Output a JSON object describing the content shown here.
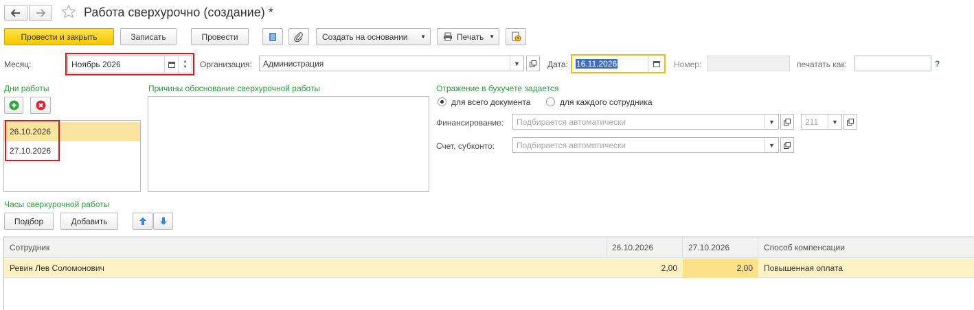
{
  "window": {
    "title": "Работа сверхурочно (создание) *"
  },
  "toolbar": {
    "post_close_label": "Провести и закрыть",
    "save_label": "Записать",
    "post_label": "Провести",
    "create_based_label": "Создать на основании",
    "print_label": "Печать"
  },
  "header": {
    "month_label": "Месяц:",
    "month_value": "Ноябрь 2026",
    "org_label": "Организация:",
    "org_value": "Администрация",
    "date_label": "Дата:",
    "date_value": "16.11.2026",
    "number_label": "Номер:",
    "number_value": "",
    "print_as_label": "печатать как:",
    "print_as_value": "",
    "help_label": "?"
  },
  "work_days": {
    "title": "Дни работы",
    "items": [
      "26.10.2026",
      "27.10.2026"
    ],
    "selected_index": 0
  },
  "reasons": {
    "title": "Причины обоснование сверхурочной работы",
    "value": ""
  },
  "accounting": {
    "title": "Отражение в бухучете задается",
    "radio_whole_doc": "для всего документа",
    "radio_each_employee": "для каждого сотрудника",
    "selected": "для всего документа",
    "financing_label": "Финансирование:",
    "financing_placeholder": "Подбирается автоматически",
    "financing_code_placeholder": "211",
    "account_label": "Счет, субконто:",
    "account_placeholder": "Подбирается автоматически"
  },
  "overtime": {
    "title": "Часы сверхурочной работы",
    "pick_label": "Подбор",
    "add_label": "Добавить",
    "columns": [
      "Сотрудник",
      "26.10.2026",
      "27.10.2026",
      "Способ компенсации"
    ],
    "rows": [
      {
        "employee": "Ревин Лев Соломонович",
        "d1": "2,00",
        "d2": "2,00",
        "compensation": "Повышенная оплата"
      }
    ]
  },
  "colors": {
    "accent_yellow": "#f5c800",
    "selection": "#fbe4a0",
    "highlight_red": "#e0141e",
    "section_green": "#2d9a3e"
  }
}
